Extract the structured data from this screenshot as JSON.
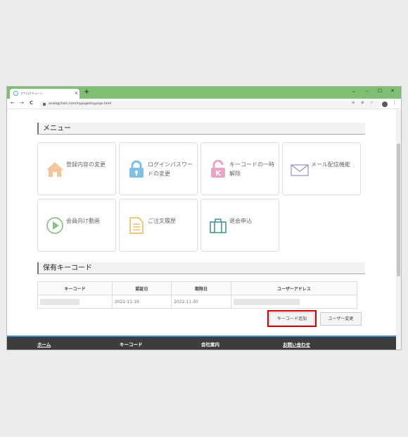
{
  "browser": {
    "tab_title": "アナログチャート",
    "tab_close": "×",
    "new_tab": "+",
    "win_controls": [
      "⌄",
      "–",
      "☐",
      "✕"
    ],
    "nav_back": "←",
    "nav_forward": "→",
    "nav_reload": "C",
    "url": "analogchart.com/mypage/mypage.html",
    "omni_icons": [
      "⊖",
      "⊕",
      "☆"
    ],
    "menu": "⋮",
    "brand_color": "#7fbf73"
  },
  "menu_section": {
    "heading": "メニュー",
    "cards": [
      {
        "label": "登録内容の変更",
        "icon": "house-icon",
        "color": "#f4c49a"
      },
      {
        "label": "ログインパスワードの変更",
        "icon": "padlock-icon",
        "color": "#7fbfe8"
      },
      {
        "label": "キーコードの一時解除",
        "icon": "unlocked-padlock-k-icon",
        "color": "#e8a6c4"
      },
      {
        "label": "メール配信機能",
        "icon": "envelope-icon",
        "color": "#9b95c9"
      },
      {
        "label": "会員向け動画",
        "icon": "play-circle-icon",
        "color": "#8cc28a"
      },
      {
        "label": "ご注文履歴",
        "icon": "document-icon",
        "color": "#f0b45a"
      },
      {
        "label": "退会申込",
        "icon": "briefcase-icon",
        "color": "#3e8f8a"
      }
    ]
  },
  "keycode_section": {
    "heading": "保有キーコード",
    "columns": [
      "キーコード",
      "認証日",
      "期限日",
      "ユーザーアドレス"
    ],
    "rows": [
      {
        "keycode": "",
        "auth_date": "2021-11-19",
        "expiry_date": "2022-11-30",
        "user_address": ""
      }
    ],
    "add_button": "キーコード追加",
    "change_button": "ユーザー変更"
  },
  "footer": {
    "links": [
      "ホーム",
      "キーコード",
      "会社案内",
      "お問い合わせ"
    ]
  }
}
